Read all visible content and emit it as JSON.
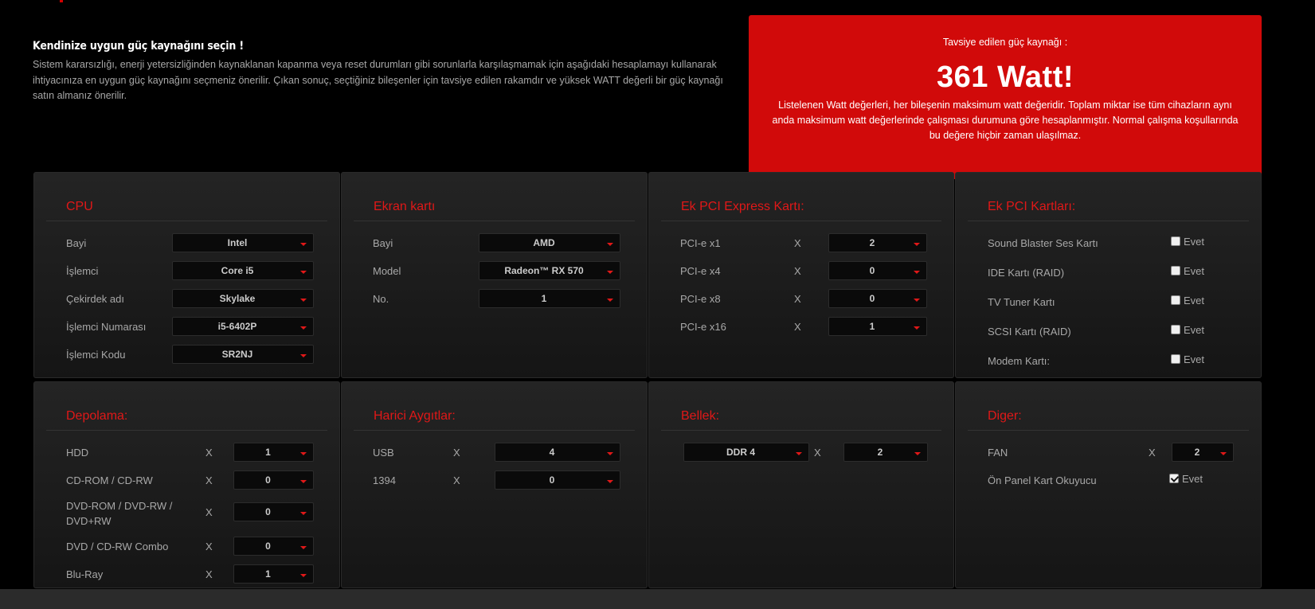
{
  "intro": {
    "title": "Kendinize uygun güç kaynağını seçin !",
    "text": "Sistem kararsızlığı, enerji yetersizliğinden kaynaklanan kapanma veya reset durumları gibi sorunlarla karşılaşmamak için aşağıdaki hesaplamayı kullanarak ihtiyacınıza en uygun güç kaynağını seçmeniz önerilir. Çıkan sonuç, seçtiğiniz bileşenler için tavsiye edilen rakamdır ve yüksek WATT değerli bir güç kaynağı satın almanız önerilir."
  },
  "result": {
    "label": "Tavsiye edilen güç kaynağı :",
    "watt": "361 Watt!",
    "note": "Listelenen Watt değerleri, her bileşenin maksimum watt değeridir. Toplam miktar ise tüm cihazların aynı anda maksimum watt değerlerinde çalışması durumuna göre hesaplanmıştır. Normal çalışma koşullarında bu değere hiçbir zaman ulaşılmaz."
  },
  "colors": {
    "accent": "#e01818",
    "callout_bg": "#d10a0a",
    "panel_bg": "#1c1c1c"
  },
  "cpu": {
    "title": "CPU",
    "rows": [
      {
        "label": "Bayi",
        "value": "Intel"
      },
      {
        "label": "İşlemci",
        "value": "Core i5"
      },
      {
        "label": "Çekirdek adı",
        "value": "Skylake"
      },
      {
        "label": "İşlemci Numarası",
        "value": "i5-6402P"
      },
      {
        "label": "İşlemci Kodu",
        "value": "SR2NJ"
      }
    ]
  },
  "gpu": {
    "title": "Ekran kartı",
    "rows": [
      {
        "label": "Bayi",
        "value": "AMD"
      },
      {
        "label": "Model",
        "value": "Radeon™ RX 570"
      },
      {
        "label": "No.",
        "value": "1"
      }
    ]
  },
  "pcie": {
    "title": "Ek PCI Express Kartı:",
    "x": "X",
    "rows": [
      {
        "label": "PCI-e x1",
        "value": "2"
      },
      {
        "label": "PCI-e x4",
        "value": "0"
      },
      {
        "label": "PCI-e x8",
        "value": "0"
      },
      {
        "label": "PCI-e x16",
        "value": "1"
      }
    ]
  },
  "pci": {
    "title": "Ek PCI Kartları:",
    "rows": [
      {
        "label": "Sound Blaster Ses Kartı",
        "check": "Evet",
        "checked": false
      },
      {
        "label": "IDE Kartı (RAID)",
        "check": "Evet",
        "checked": false
      },
      {
        "label": "TV Tuner Kartı",
        "check": "Evet",
        "checked": false
      },
      {
        "label": "SCSI Kartı (RAID)",
        "check": "Evet",
        "checked": false
      },
      {
        "label": "Modem Kartı:",
        "check": "Evet",
        "checked": false
      }
    ]
  },
  "storage": {
    "title": "Depolama:",
    "x": "X",
    "rows": [
      {
        "label": "HDD",
        "value": "1"
      },
      {
        "label": "CD-ROM / CD-RW",
        "value": "0"
      },
      {
        "label": "DVD-ROM / DVD-RW / DVD+RW",
        "value": "0"
      },
      {
        "label": "DVD / CD-RW Combo",
        "value": "0"
      },
      {
        "label": "Blu-Ray",
        "value": "1"
      }
    ]
  },
  "external": {
    "title": "Harici Aygıtlar:",
    "x": "X",
    "rows": [
      {
        "label": "USB",
        "value": "4"
      },
      {
        "label": "1394",
        "value": "0"
      }
    ]
  },
  "memory": {
    "title": "Bellek:",
    "type": "DDR 4",
    "x": "X",
    "count": "2"
  },
  "other": {
    "title": "Diger:",
    "fan_label": "FAN",
    "x": "X",
    "fan_value": "2",
    "reader_label": "Ön Panel Kart Okuyucu",
    "reader_check": "Evet",
    "reader_checked": true
  }
}
